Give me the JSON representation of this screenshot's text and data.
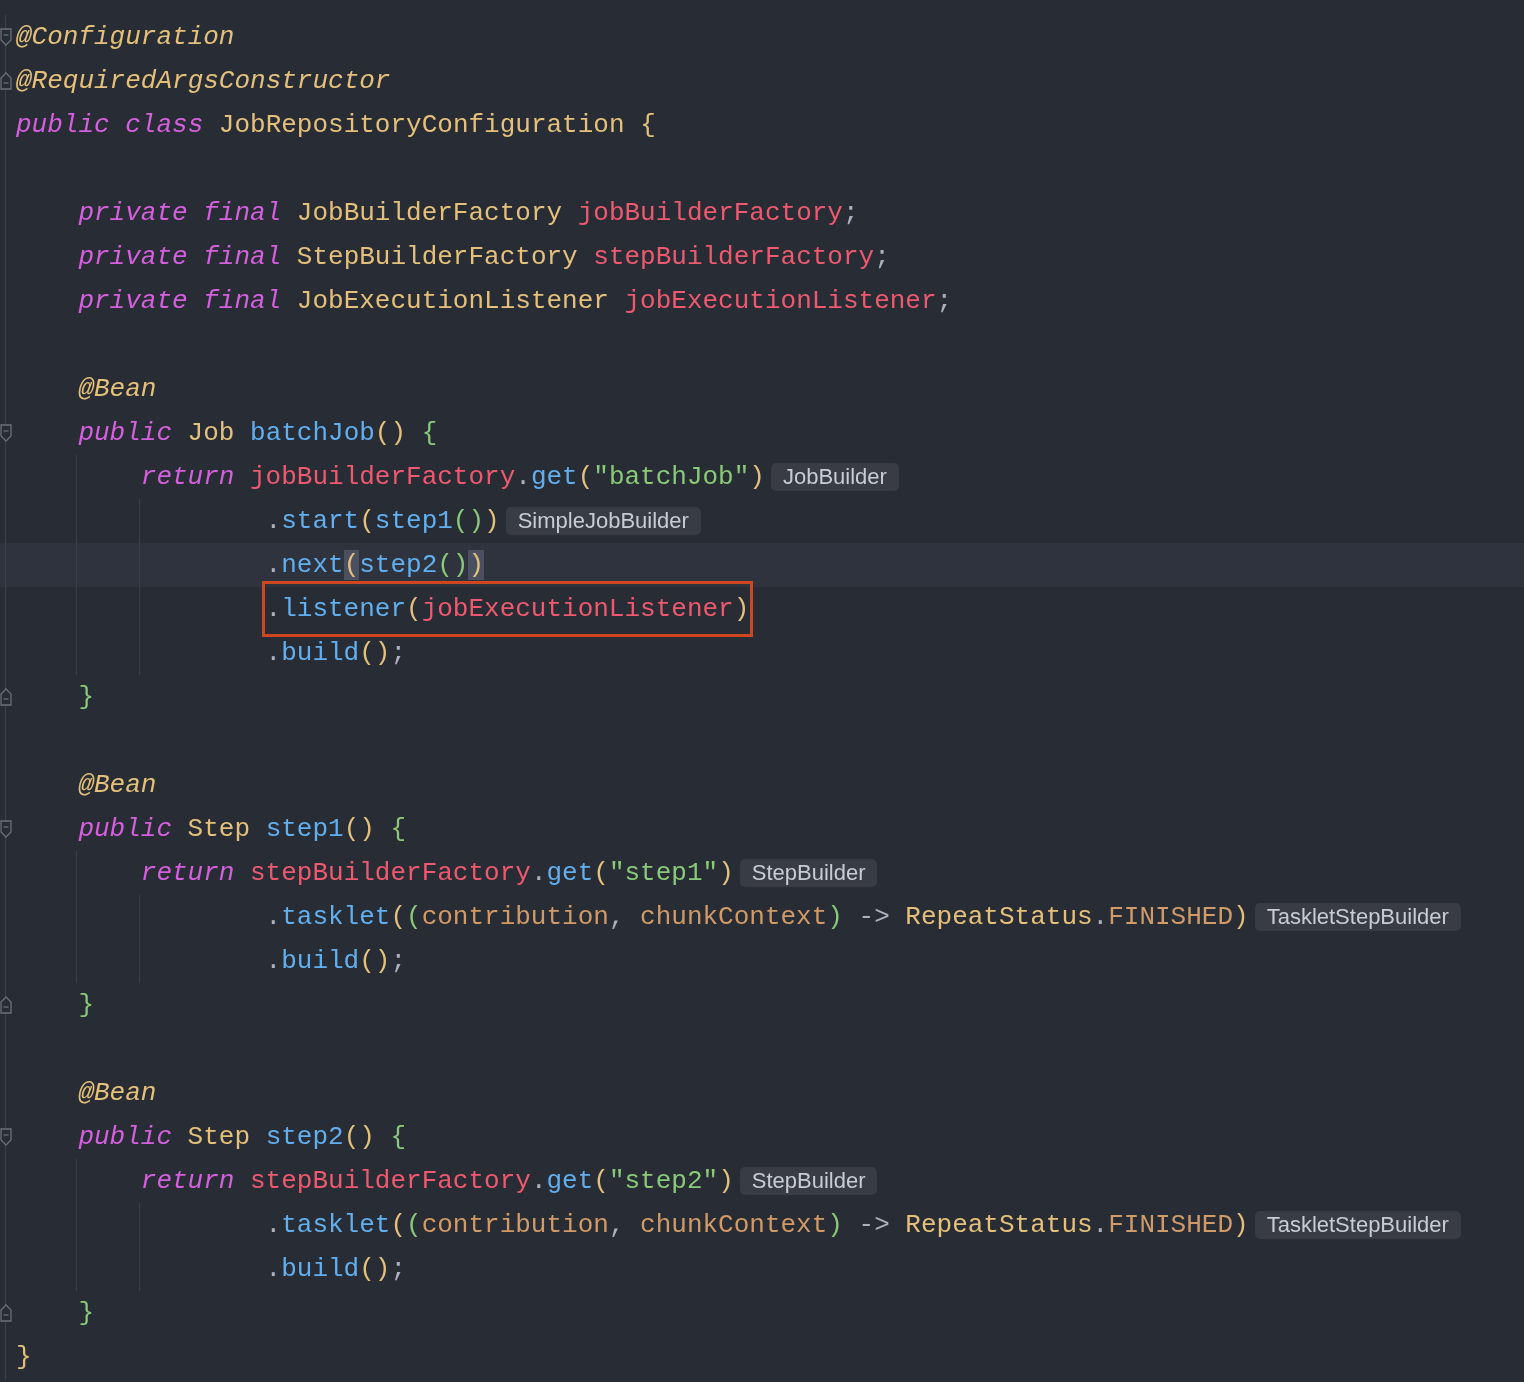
{
  "editor": {
    "lines": [
      {
        "kind": "top",
        "fold": {
          "kind": "start"
        },
        "tokens": [
          {
            "text": "@Configuration",
            "kind": "annotation"
          }
        ]
      },
      {
        "kind": "top",
        "fold": {
          "kind": "end"
        },
        "tokens": [
          {
            "text": "@RequiredArgsConstructor",
            "kind": "annotation"
          }
        ]
      },
      {
        "kind": "top",
        "tokens": [
          {
            "text": "public ",
            "kind": "keyword"
          },
          {
            "text": "class ",
            "kind": "keyword"
          },
          {
            "text": "JobRepositoryConfiguration ",
            "kind": "type"
          },
          {
            "text": "{",
            "kind": "paren1"
          }
        ]
      },
      {
        "kind": "blank"
      },
      {
        "kind": "member",
        "tokens": [
          {
            "text": "private ",
            "kind": "keyword"
          },
          {
            "text": "final ",
            "kind": "keyword"
          },
          {
            "text": "JobBuilderFactory ",
            "kind": "type"
          },
          {
            "text": "jobBuilderFactory",
            "kind": "field"
          },
          {
            "text": ";",
            "kind": "punct"
          }
        ]
      },
      {
        "kind": "member",
        "tokens": [
          {
            "text": "private ",
            "kind": "keyword"
          },
          {
            "text": "final ",
            "kind": "keyword"
          },
          {
            "text": "StepBuilderFactory ",
            "kind": "type"
          },
          {
            "text": "stepBuilderFactory",
            "kind": "field"
          },
          {
            "text": ";",
            "kind": "punct"
          }
        ]
      },
      {
        "kind": "member",
        "tokens": [
          {
            "text": "private ",
            "kind": "keyword"
          },
          {
            "text": "final ",
            "kind": "keyword"
          },
          {
            "text": "JobExecutionListener ",
            "kind": "type"
          },
          {
            "text": "jobExecutionListener",
            "kind": "field"
          },
          {
            "text": ";",
            "kind": "punct"
          }
        ]
      },
      {
        "kind": "blank"
      },
      {
        "kind": "member",
        "tokens": [
          {
            "text": "@Bean",
            "kind": "annotation"
          }
        ]
      },
      {
        "kind": "member",
        "fold": {
          "kind": "start"
        },
        "tokens": [
          {
            "text": "public ",
            "kind": "keyword"
          },
          {
            "text": "Job ",
            "kind": "type"
          },
          {
            "text": "batchJob",
            "kind": "method"
          },
          {
            "text": "() ",
            "kind": "paren1"
          },
          {
            "text": "{",
            "kind": "paren2"
          }
        ]
      },
      {
        "kind": "body",
        "hint": "JobBuilder",
        "tokens": [
          {
            "text": "return ",
            "kind": "keyword"
          },
          {
            "text": "jobBuilderFactory",
            "kind": "field"
          },
          {
            "text": ".",
            "kind": "punct"
          },
          {
            "text": "get",
            "kind": "method"
          },
          {
            "text": "(",
            "kind": "paren1"
          },
          {
            "text": "\"batchJob\"",
            "kind": "string"
          },
          {
            "text": ")",
            "kind": "paren1"
          }
        ]
      },
      {
        "kind": "chain",
        "hint": "SimpleJobBuilder",
        "tokens": [
          {
            "text": ".",
            "kind": "punct"
          },
          {
            "text": "start",
            "kind": "method"
          },
          {
            "text": "(",
            "kind": "paren1"
          },
          {
            "text": "step1",
            "kind": "method"
          },
          {
            "text": "()",
            "kind": "paren2"
          },
          {
            "text": ")",
            "kind": "paren1"
          }
        ]
      },
      {
        "kind": "chain",
        "current": true,
        "tokens": [
          {
            "text": ".",
            "kind": "punct"
          },
          {
            "text": "next",
            "kind": "method"
          },
          {
            "text": "(",
            "kind": "paren1",
            "matched": true
          },
          {
            "text": "step2",
            "kind": "method"
          },
          {
            "text": "()",
            "kind": "paren2"
          },
          {
            "text": ")",
            "kind": "paren1",
            "matched": true
          }
        ]
      },
      {
        "kind": "chain",
        "boxed": true,
        "tokens": [
          {
            "text": ".",
            "kind": "punct"
          },
          {
            "text": "listener",
            "kind": "method"
          },
          {
            "text": "(",
            "kind": "paren1"
          },
          {
            "text": "jobExecutionListener",
            "kind": "field"
          },
          {
            "text": ")",
            "kind": "paren1"
          }
        ]
      },
      {
        "kind": "chain",
        "tokens": [
          {
            "text": ".",
            "kind": "punct"
          },
          {
            "text": "build",
            "kind": "method"
          },
          {
            "text": "()",
            "kind": "paren1"
          },
          {
            "text": ";",
            "kind": "punct"
          }
        ]
      },
      {
        "kind": "member",
        "fold": {
          "kind": "end"
        },
        "tokens": [
          {
            "text": "}",
            "kind": "paren2"
          }
        ]
      },
      {
        "kind": "blank"
      },
      {
        "kind": "member",
        "tokens": [
          {
            "text": "@Bean",
            "kind": "annotation"
          }
        ]
      },
      {
        "kind": "member",
        "fold": {
          "kind": "start"
        },
        "tokens": [
          {
            "text": "public ",
            "kind": "keyword"
          },
          {
            "text": "Step ",
            "kind": "type"
          },
          {
            "text": "step1",
            "kind": "method"
          },
          {
            "text": "() ",
            "kind": "paren1"
          },
          {
            "text": "{",
            "kind": "paren2"
          }
        ]
      },
      {
        "kind": "body",
        "hint": "StepBuilder",
        "tokens": [
          {
            "text": "return ",
            "kind": "keyword"
          },
          {
            "text": "stepBuilderFactory",
            "kind": "field"
          },
          {
            "text": ".",
            "kind": "punct"
          },
          {
            "text": "get",
            "kind": "method"
          },
          {
            "text": "(",
            "kind": "paren1"
          },
          {
            "text": "\"step1\"",
            "kind": "string"
          },
          {
            "text": ")",
            "kind": "paren1"
          }
        ]
      },
      {
        "kind": "chain",
        "hint": "TaskletStepBuilder",
        "tokens": [
          {
            "text": ".",
            "kind": "punct"
          },
          {
            "text": "tasklet",
            "kind": "method"
          },
          {
            "text": "(",
            "kind": "paren1"
          },
          {
            "text": "(",
            "kind": "paren2"
          },
          {
            "text": "contribution",
            "kind": "param"
          },
          {
            "text": ", ",
            "kind": "punct"
          },
          {
            "text": "chunkContext",
            "kind": "param"
          },
          {
            "text": ")",
            "kind": "paren2"
          },
          {
            "text": " -> ",
            "kind": "punct"
          },
          {
            "text": "RepeatStatus",
            "kind": "type"
          },
          {
            "text": ".",
            "kind": "punct"
          },
          {
            "text": "FINISHED",
            "kind": "constant"
          },
          {
            "text": ")",
            "kind": "paren1"
          }
        ]
      },
      {
        "kind": "chain",
        "tokens": [
          {
            "text": ".",
            "kind": "punct"
          },
          {
            "text": "build",
            "kind": "method"
          },
          {
            "text": "()",
            "kind": "paren1"
          },
          {
            "text": ";",
            "kind": "punct"
          }
        ]
      },
      {
        "kind": "member",
        "fold": {
          "kind": "end"
        },
        "tokens": [
          {
            "text": "}",
            "kind": "paren2"
          }
        ]
      },
      {
        "kind": "blank"
      },
      {
        "kind": "member",
        "tokens": [
          {
            "text": "@Bean",
            "kind": "annotation"
          }
        ]
      },
      {
        "kind": "member",
        "fold": {
          "kind": "start"
        },
        "tokens": [
          {
            "text": "public ",
            "kind": "keyword"
          },
          {
            "text": "Step ",
            "kind": "type"
          },
          {
            "text": "step2",
            "kind": "method"
          },
          {
            "text": "() ",
            "kind": "paren1"
          },
          {
            "text": "{",
            "kind": "paren2"
          }
        ]
      },
      {
        "kind": "body",
        "hint": "StepBuilder",
        "tokens": [
          {
            "text": "return ",
            "kind": "keyword"
          },
          {
            "text": "stepBuilderFactory",
            "kind": "field"
          },
          {
            "text": ".",
            "kind": "punct"
          },
          {
            "text": "get",
            "kind": "method"
          },
          {
            "text": "(",
            "kind": "paren1"
          },
          {
            "text": "\"step2\"",
            "kind": "string"
          },
          {
            "text": ")",
            "kind": "paren1"
          }
        ]
      },
      {
        "kind": "chain",
        "hint": "TaskletStepBuilder",
        "tokens": [
          {
            "text": ".",
            "kind": "punct"
          },
          {
            "text": "tasklet",
            "kind": "method"
          },
          {
            "text": "(",
            "kind": "paren1"
          },
          {
            "text": "(",
            "kind": "paren2"
          },
          {
            "text": "contribution",
            "kind": "param"
          },
          {
            "text": ", ",
            "kind": "punct"
          },
          {
            "text": "chunkContext",
            "kind": "param"
          },
          {
            "text": ")",
            "kind": "paren2"
          },
          {
            "text": " -> ",
            "kind": "punct"
          },
          {
            "text": "RepeatStatus",
            "kind": "type"
          },
          {
            "text": ".",
            "kind": "punct"
          },
          {
            "text": "FINISHED",
            "kind": "constant"
          },
          {
            "text": ")",
            "kind": "paren1"
          }
        ]
      },
      {
        "kind": "chain",
        "tokens": [
          {
            "text": ".",
            "kind": "punct"
          },
          {
            "text": "build",
            "kind": "method"
          },
          {
            "text": "()",
            "kind": "paren1"
          },
          {
            "text": ";",
            "kind": "punct"
          }
        ]
      },
      {
        "kind": "member",
        "fold": {
          "kind": "end"
        },
        "tokens": [
          {
            "text": "}",
            "kind": "paren2"
          }
        ]
      },
      {
        "kind": "top",
        "tokens": [
          {
            "text": "}",
            "kind": "paren1"
          }
        ]
      }
    ]
  }
}
